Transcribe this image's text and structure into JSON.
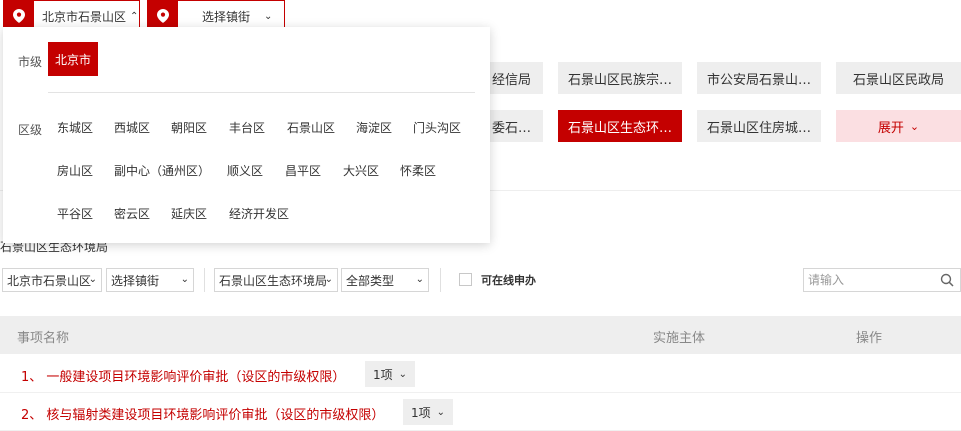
{
  "location": {
    "city_label": "北京市石景山区",
    "town_label": "选择镇街"
  },
  "departments": [
    "经信局",
    "石景山区民族宗…",
    "市公安局石景山…",
    "石景山区民政局",
    "委石…",
    "石景山区生态环…",
    "石景山区住房城…"
  ],
  "expand_label": "展开",
  "dropdown": {
    "city_level_label": "市级",
    "city": "北京市",
    "district_level_label": "区级",
    "districts": [
      "东城区",
      "西城区",
      "朝阳区",
      "丰台区",
      "石景山区",
      "海淀区",
      "门头沟区",
      "房山区",
      "副中心（通州区）",
      "顺义区",
      "昌平区",
      "大兴区",
      "怀柔区",
      "平谷区",
      "密云区",
      "延庆区",
      "经济开发区"
    ]
  },
  "breadcrumb": "石景山区生态环境局",
  "filters": {
    "city": "北京市石景山区",
    "town": "选择镇街",
    "department": "石景山区生态环境局",
    "type": "全部类型",
    "online_label": "可在线申办",
    "search_placeholder": "请输入"
  },
  "table": {
    "headers": [
      "事项名称",
      "实施主体",
      "操作"
    ],
    "rows": [
      {
        "name": "1、 一般建设项目环境影响评价审批（设区的市级权限）",
        "count": "1项"
      },
      {
        "name": "2、 核与辐射类建设项目环境影响评价审批（设区的市级权限）",
        "count": "1项"
      }
    ]
  },
  "colors": {
    "accent": "#c40000",
    "expand_bg": "#fbdfe2",
    "chip_bg": "#eeeeee"
  }
}
